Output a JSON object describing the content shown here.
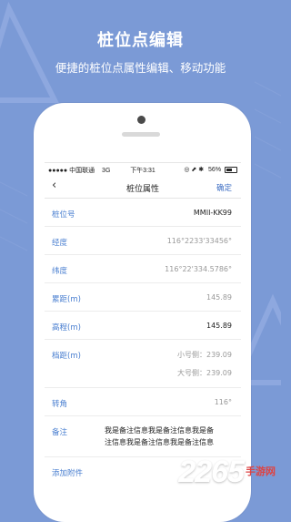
{
  "promo": {
    "title": "桩位点编辑",
    "subtitle": "便捷的桩位点属性编辑、移动功能"
  },
  "status_bar": {
    "carrier": "●●●●● 中国联通",
    "network": "3G",
    "time": "下午3:31",
    "icons": "◎ ⬈ ✱",
    "battery": "56%"
  },
  "nav": {
    "back_icon": "‹",
    "title": "桩位属性",
    "confirm": "确定"
  },
  "fields": {
    "pile_no": {
      "label": "桩位号",
      "value": "MMII-KK99"
    },
    "longitude": {
      "label": "经度",
      "value": "116°2233'33456°"
    },
    "latitude": {
      "label": "纬度",
      "value": "116°22'334.5786°"
    },
    "cum_distance": {
      "label": "累距(m)",
      "value": "145.89"
    },
    "elevation": {
      "label": "高程(m)",
      "value": "145.89"
    },
    "span": {
      "label": "档距(m)",
      "small_side": "小号侧：239.09",
      "large_side": "大号侧：239.09"
    },
    "angle": {
      "label": "转角",
      "value": "116°"
    },
    "note": {
      "label": "备注",
      "value": "我是备注信息我是备注信息我是备注信息我是备注信息我是备注信息"
    },
    "attach": {
      "label": "添加附件"
    }
  },
  "watermark": {
    "number": "2265",
    "site": "手游网"
  },
  "colors": {
    "background": "#7b9ad6",
    "accent": "#4a7fd0"
  }
}
